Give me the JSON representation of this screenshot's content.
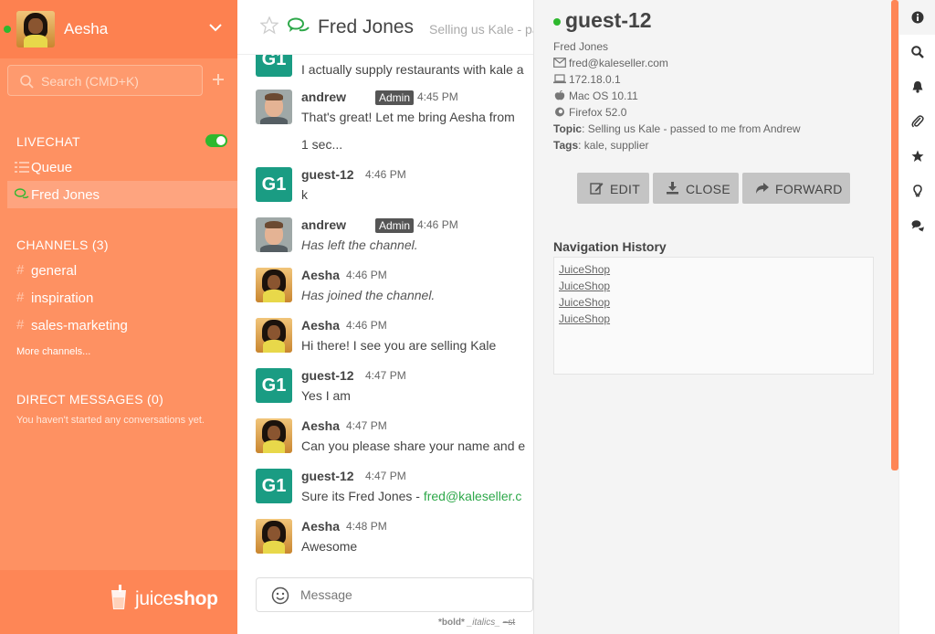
{
  "user": {
    "name": "Aesha",
    "status": "online"
  },
  "search": {
    "placeholder": "Search (CMD+K)"
  },
  "livechat": {
    "title": "LIVECHAT",
    "items": [
      {
        "label": "Queue",
        "icon": "list-icon"
      },
      {
        "label": "Fred Jones",
        "icon": "chat-bubbles-icon",
        "active": true
      }
    ]
  },
  "channels": {
    "title": "CHANNELS (3)",
    "items": [
      {
        "label": "general"
      },
      {
        "label": "inspiration"
      },
      {
        "label": "sales-marketing"
      }
    ],
    "more": "More channels..."
  },
  "direct_messages": {
    "title": "DIRECT MESSAGES (0)",
    "empty": "You haven't started any conversations yet."
  },
  "brand": {
    "part1": "juice",
    "part2": "shop"
  },
  "room": {
    "title": "Fred Jones",
    "topic": "Selling us Kale - passed to me from Andrew"
  },
  "messages": [
    {
      "author": "",
      "avatar": "G1",
      "time": "",
      "text": "I actually supply restaurants with kale a"
    },
    {
      "author": "andrew",
      "badge": "Admin",
      "time": "4:45 PM",
      "text": "That's great! Let me bring Aesha from",
      "text2": "1 sec..."
    },
    {
      "author": "guest-12",
      "avatar": "G1",
      "time": "4:46 PM",
      "text": "k"
    },
    {
      "author": "andrew",
      "badge": "Admin",
      "time": "4:46 PM",
      "text": "Has left the channel."
    },
    {
      "author": "Aesha",
      "time": "4:46 PM",
      "text": "Has joined the channel."
    },
    {
      "author": "Aesha",
      "time": "4:46 PM",
      "text": "Hi there! I see you are selling Kale"
    },
    {
      "author": "guest-12",
      "avatar": "G1",
      "time": "4:47 PM",
      "text": "Yes I am"
    },
    {
      "author": "Aesha",
      "time": "4:47 PM",
      "text": "Can you please share your name and e"
    },
    {
      "author": "guest-12",
      "avatar": "G1",
      "time": "4:47 PM",
      "text": "Sure its Fred Jones - ",
      "link": "fred@kaleseller.c"
    },
    {
      "author": "Aesha",
      "time": "4:48 PM",
      "text": "Awesome"
    }
  ],
  "composer": {
    "placeholder": "Message",
    "hint_bold": "*bold*",
    "hint_italic": "_italics_",
    "hint_strike": "~st"
  },
  "visitor": {
    "name": "guest-12",
    "full_name": "Fred Jones",
    "email": "fred@kaleseller.com",
    "ip": "172.18.0.1",
    "os": "Mac OS 10.11",
    "browser": "Firefox 52.0",
    "topic_label": "Topic",
    "topic": "Selling us Kale - passed to me from Andrew",
    "tags_label": "Tags",
    "tags": "kale, supplier"
  },
  "actions": {
    "edit": "EDIT",
    "close": "CLOSE",
    "forward": "FORWARD"
  },
  "navigation": {
    "title": "Navigation History",
    "links": [
      "JuiceShop",
      "JuiceShop",
      "JuiceShop",
      "JuiceShop"
    ]
  },
  "toolbar": [
    "info-icon",
    "search-icon",
    "bell-icon",
    "paperclip-icon",
    "star-icon",
    "lightbulb-icon",
    "comments-icon"
  ],
  "colors": {
    "sidebar": "#fe9162",
    "accent": "#fe8656",
    "online": "#2eb82e",
    "guest_avatar": "#1a9c83",
    "link": "#2ea84a"
  }
}
